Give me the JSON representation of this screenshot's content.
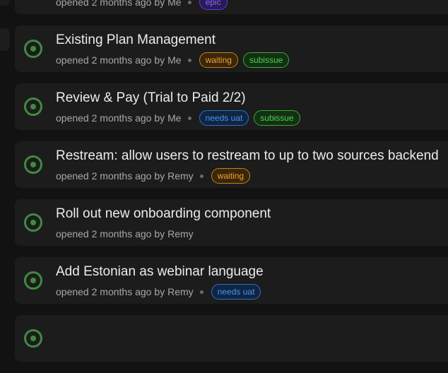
{
  "issues": [
    {
      "title": "",
      "opened": "opened 2 months ago by",
      "author": "Me",
      "labels": [
        {
          "text": "epic",
          "kind": "epic"
        }
      ]
    },
    {
      "title": "Existing Plan Management",
      "opened": "opened 2 months ago by",
      "author": "Me",
      "labels": [
        {
          "text": "waiting",
          "kind": "waiting"
        },
        {
          "text": "subissue",
          "kind": "subissue"
        }
      ]
    },
    {
      "title": "Review & Pay (Trial to Paid 2/2)",
      "opened": "opened 2 months ago by",
      "author": "Me",
      "labels": [
        {
          "text": "needs uat",
          "kind": "needs-uat"
        },
        {
          "text": "subissue",
          "kind": "subissue"
        }
      ]
    },
    {
      "title": "Restream: allow users to restream to up to two sources backend",
      "opened": "opened 2 months ago by",
      "author": "Remy",
      "labels": [
        {
          "text": "waiting",
          "kind": "waiting"
        }
      ]
    },
    {
      "title": "Roll out new onboarding component",
      "opened": "opened 2 months ago by",
      "author": "Remy",
      "labels": []
    },
    {
      "title": "Add Estonian as webinar language",
      "opened": "opened 2 months ago by",
      "author": "Remy",
      "labels": [
        {
          "text": "needs uat",
          "kind": "needs-uat"
        }
      ]
    },
    {
      "title": "",
      "opened": "",
      "author": "",
      "labels": []
    }
  ],
  "colors": {
    "open_status": "#3f8a3f",
    "waiting": "#f2a23a",
    "subissue": "#4fd24f",
    "needs_uat": "#4a93ea",
    "epic": "#8b6cf0"
  },
  "icons": {
    "status": "open-issue-icon"
  }
}
